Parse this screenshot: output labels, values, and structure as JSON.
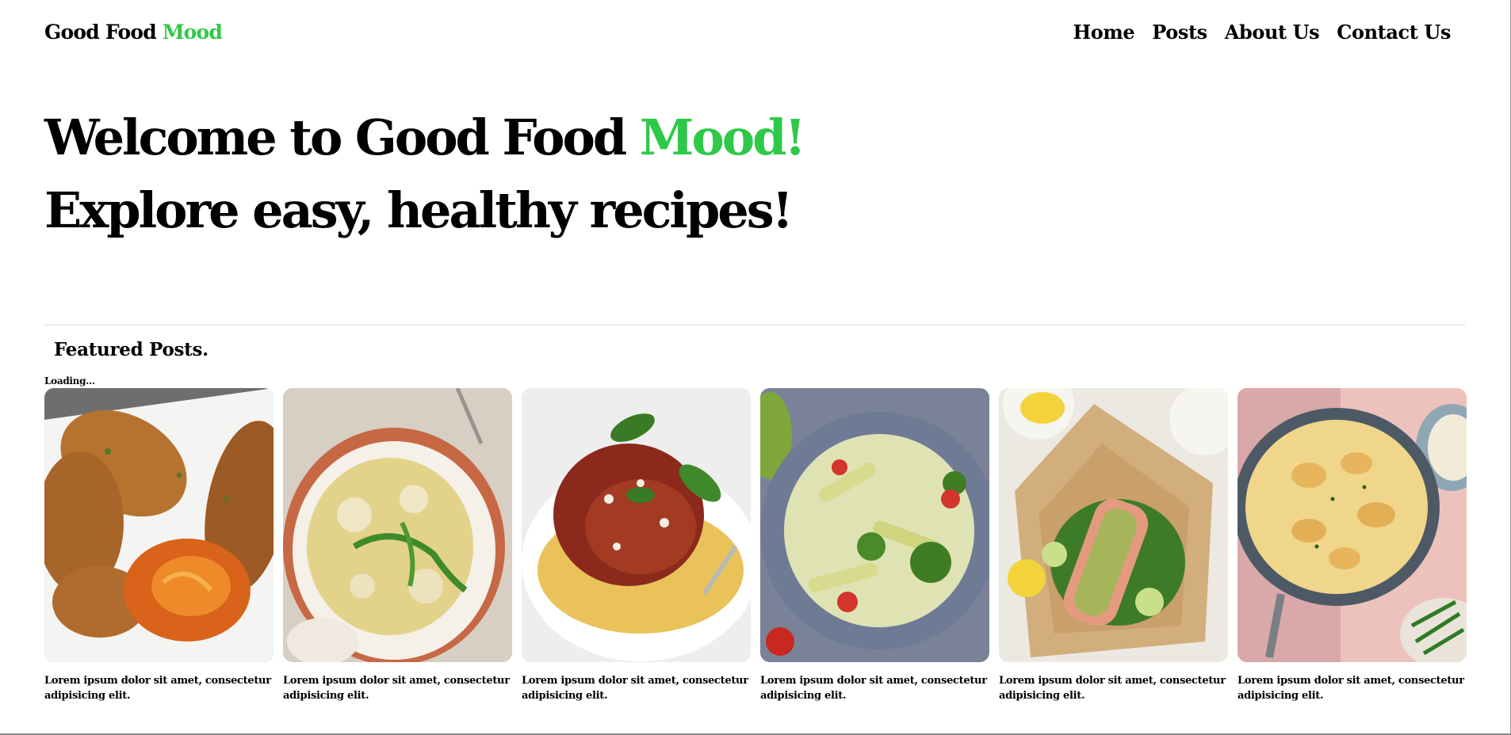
{
  "header": {
    "logo_main": "Good Food ",
    "logo_accent": "Mood",
    "nav": [
      "Home",
      "Posts",
      "About Us",
      "Contact Us"
    ]
  },
  "hero": {
    "line1_main": "Welcome to Good Food ",
    "line1_accent": "Mood!",
    "line2": "Explore easy, healthy recipes!"
  },
  "featured": {
    "title": "Featured Posts.",
    "loading": "Loading...",
    "posts": [
      {
        "image": "chicken-tenders-with-sauce",
        "text": "Lorem ipsum dolor sit amet, consectetur adipisicing elit."
      },
      {
        "image": "cauliflower-pasta-with-arugula",
        "text": "Lorem ipsum dolor sit amet, consectetur adipisicing elit."
      },
      {
        "image": "spaghetti-bolognese",
        "text": "Lorem ipsum dolor sit amet, consectetur adipisicing elit."
      },
      {
        "image": "penne-broccoli-pesto",
        "text": "Lorem ipsum dolor sit amet, consectetur adipisicing elit."
      },
      {
        "image": "salmon-parcel-with-greens",
        "text": "Lorem ipsum dolor sit amet, consectetur adipisicing elit."
      },
      {
        "image": "creamy-chicken-skillet",
        "text": "Lorem ipsum dolor sit amet, consectetur adipisicing elit."
      }
    ]
  },
  "colors": {
    "accent": "#2fc94a",
    "text": "#000000",
    "background": "#ffffff",
    "divider": "#d6d6d6"
  }
}
